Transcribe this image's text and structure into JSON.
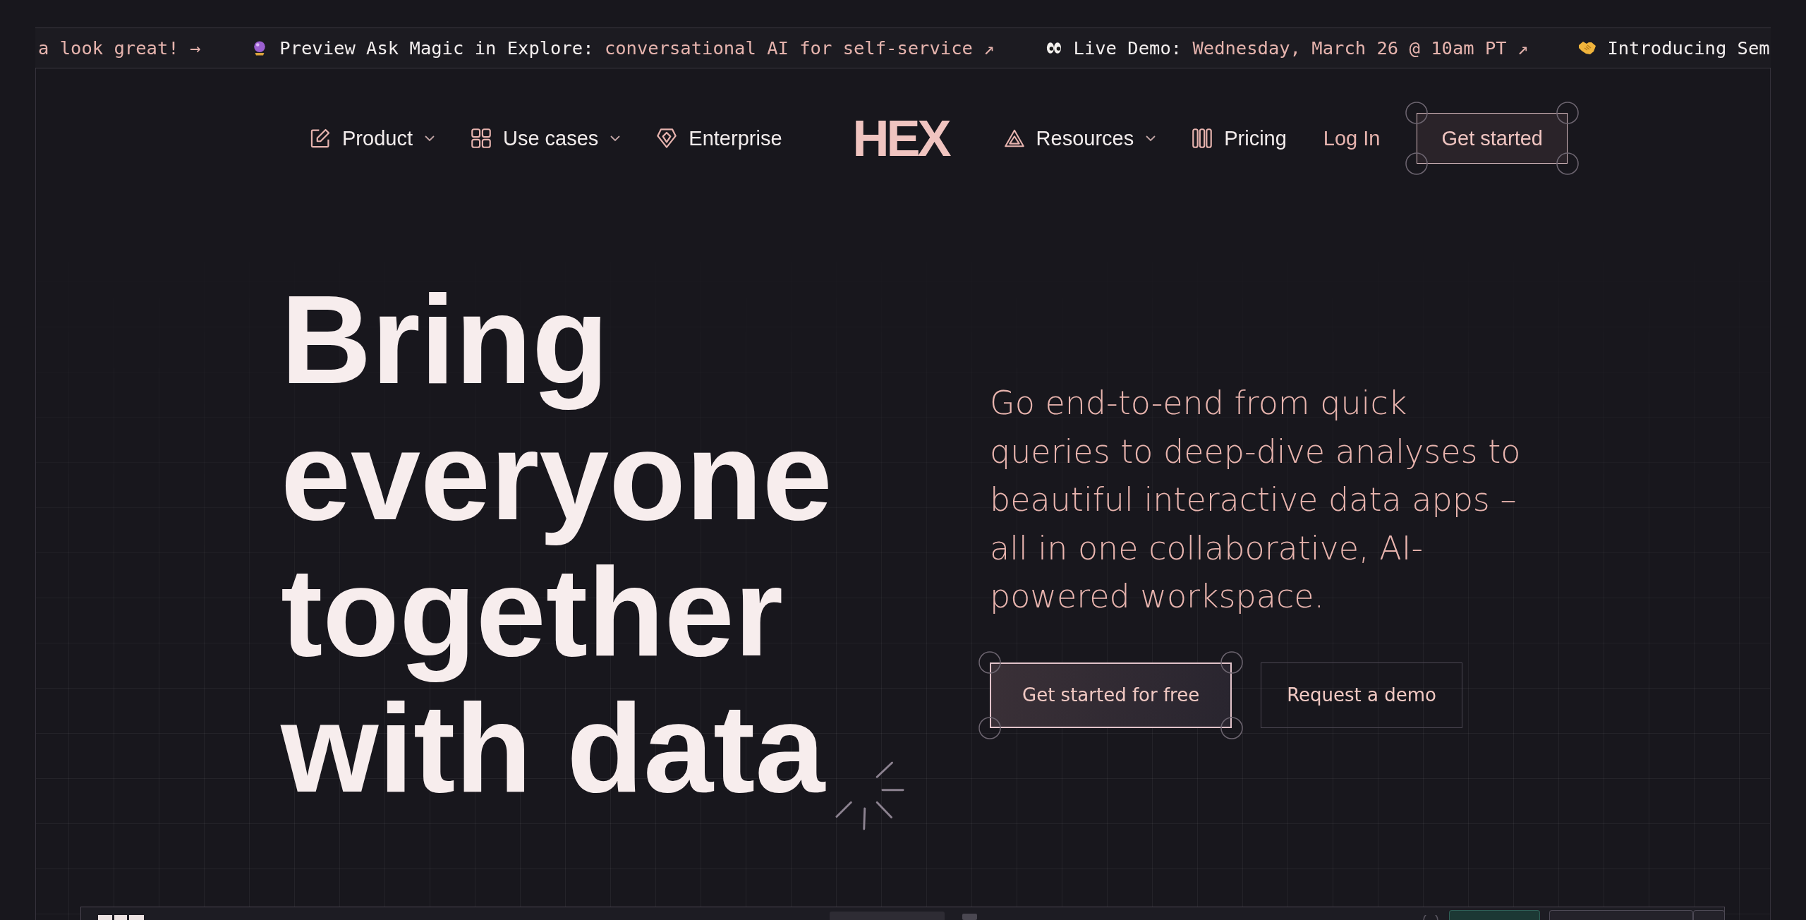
{
  "announcements": [
    {
      "link": "a look great! →"
    },
    {
      "title": "Preview Ask Magic in Explore:",
      "link": "conversational AI for self-service ↗"
    },
    {
      "title": "Live Demo:",
      "link": "Wednesday, March 26 @ 10am PT ↗"
    },
    {
      "title": "Introducing Sem"
    }
  ],
  "nav": {
    "left": [
      {
        "label": "Product",
        "dropdown": true
      },
      {
        "label": "Use cases",
        "dropdown": true
      },
      {
        "label": "Enterprise",
        "dropdown": false
      }
    ],
    "logo": "HEX",
    "right": [
      {
        "label": "Resources",
        "dropdown": true
      },
      {
        "label": "Pricing",
        "dropdown": false
      }
    ],
    "login": "Log In",
    "cta": "Get started"
  },
  "hero": {
    "heading_lines": [
      "Bring",
      "everyone",
      "together",
      "with data"
    ],
    "description": "Go end-to-end from quick queries to deep-dive analyses to beautiful interactive data apps – all in one collaborative, AI-powered workspace.",
    "buttons": [
      {
        "label": "Get started for free",
        "kind": "primary"
      },
      {
        "label": "Request a demo",
        "kind": "secondary"
      }
    ]
  }
}
